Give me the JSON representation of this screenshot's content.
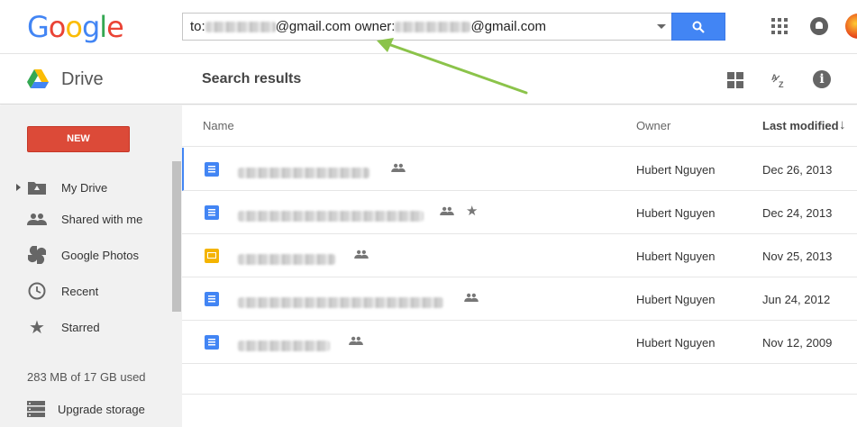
{
  "header": {
    "logo_letters": [
      "G",
      "o",
      "o",
      "g",
      "l",
      "e"
    ],
    "logo_colors": [
      "#4285f4",
      "#ea4335",
      "#fbbc05",
      "#4285f4",
      "#34a853",
      "#ea4335"
    ],
    "search": {
      "prefix": "to:",
      "middle": "@gmail.com owner:",
      "suffix": "@gmail.com"
    }
  },
  "subheader": {
    "app_name": "Drive",
    "title": "Search results"
  },
  "sidebar": {
    "new_label": "NEW",
    "items": [
      {
        "label": "My Drive",
        "icon": "my-drive-icon"
      },
      {
        "label": "Shared with me",
        "icon": "shared-icon"
      },
      {
        "label": "Google Photos",
        "icon": "photos-icon"
      },
      {
        "label": "Recent",
        "icon": "clock-icon"
      },
      {
        "label": "Starred",
        "icon": "star-icon"
      }
    ],
    "storage": "283 MB of 17 GB used",
    "upgrade_label": "Upgrade storage"
  },
  "list": {
    "headers": {
      "name": "Name",
      "owner": "Owner",
      "modified": "Last modified"
    },
    "rows": [
      {
        "type": "doc",
        "owner": "Hubert Nguyen",
        "modified": "Dec 26, 2013",
        "shared": true,
        "starred": false
      },
      {
        "type": "doc",
        "owner": "Hubert Nguyen",
        "modified": "Dec 24, 2013",
        "shared": true,
        "starred": true
      },
      {
        "type": "slide",
        "owner": "Hubert Nguyen",
        "modified": "Nov 25, 2013",
        "shared": true,
        "starred": false
      },
      {
        "type": "doc",
        "owner": "Hubert Nguyen",
        "modified": "Jun 24, 2012",
        "shared": true,
        "starred": false
      },
      {
        "type": "doc",
        "owner": "Hubert Nguyen",
        "modified": "Nov 12, 2009",
        "shared": true,
        "starred": false
      }
    ]
  },
  "colors": {
    "accent": "#4285f4",
    "new_button": "#dc4a38",
    "annotation_arrow": "#8bc34a",
    "slide_icon": "#f4b400"
  }
}
